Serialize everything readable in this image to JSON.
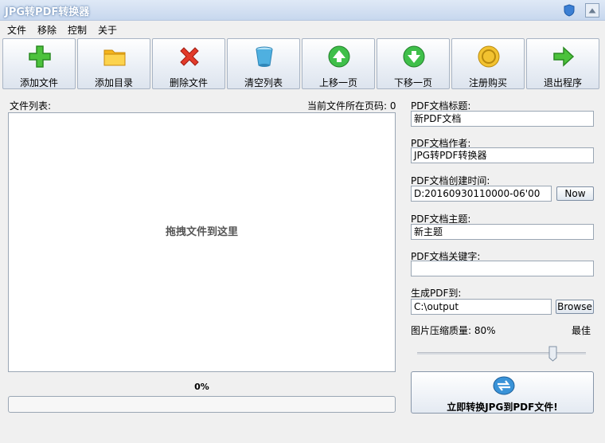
{
  "window": {
    "title": "JPG转PDF转换器"
  },
  "menu": [
    "文件",
    "移除",
    "控制",
    "关于"
  ],
  "toolbar": [
    {
      "label": "添加文件",
      "icon": "plus-icon"
    },
    {
      "label": "添加目录",
      "icon": "folder-icon"
    },
    {
      "label": "删除文件",
      "icon": "delete-x-icon"
    },
    {
      "label": "清空列表",
      "icon": "bucket-icon"
    },
    {
      "label": "上移一页",
      "icon": "arrow-up-icon"
    },
    {
      "label": "下移一页",
      "icon": "arrow-down-icon"
    },
    {
      "label": "注册购买",
      "icon": "coin-icon"
    },
    {
      "label": "退出程序",
      "icon": "exit-arrow-icon"
    }
  ],
  "file_list": {
    "label": "文件列表:",
    "current_page_label": "当前文件所在页码: 0",
    "drop_hint": "拖拽文件到这里"
  },
  "progress": {
    "text": "0%",
    "value": 0
  },
  "pdf": {
    "title_label": "PDF文档标题:",
    "title_value": "新PDF文档",
    "author_label": "PDF文档作者:",
    "author_value": "JPG转PDF转换器",
    "created_label": "PDF文档创建时间:",
    "created_value": "D:20160930110000-06'00",
    "now_button": "Now",
    "subject_label": "PDF文档主题:",
    "subject_value": "新主题",
    "keywords_label": "PDF文档关键字:",
    "keywords_value": "",
    "output_label": "生成PDF到:",
    "output_value": "C:\\output",
    "browse_button": "Browse",
    "quality_label": "图片压缩质量: 80%",
    "quality_best": "最佳",
    "quality_value": 80
  },
  "convert_button": "立即转换JPG到PDF文件!"
}
